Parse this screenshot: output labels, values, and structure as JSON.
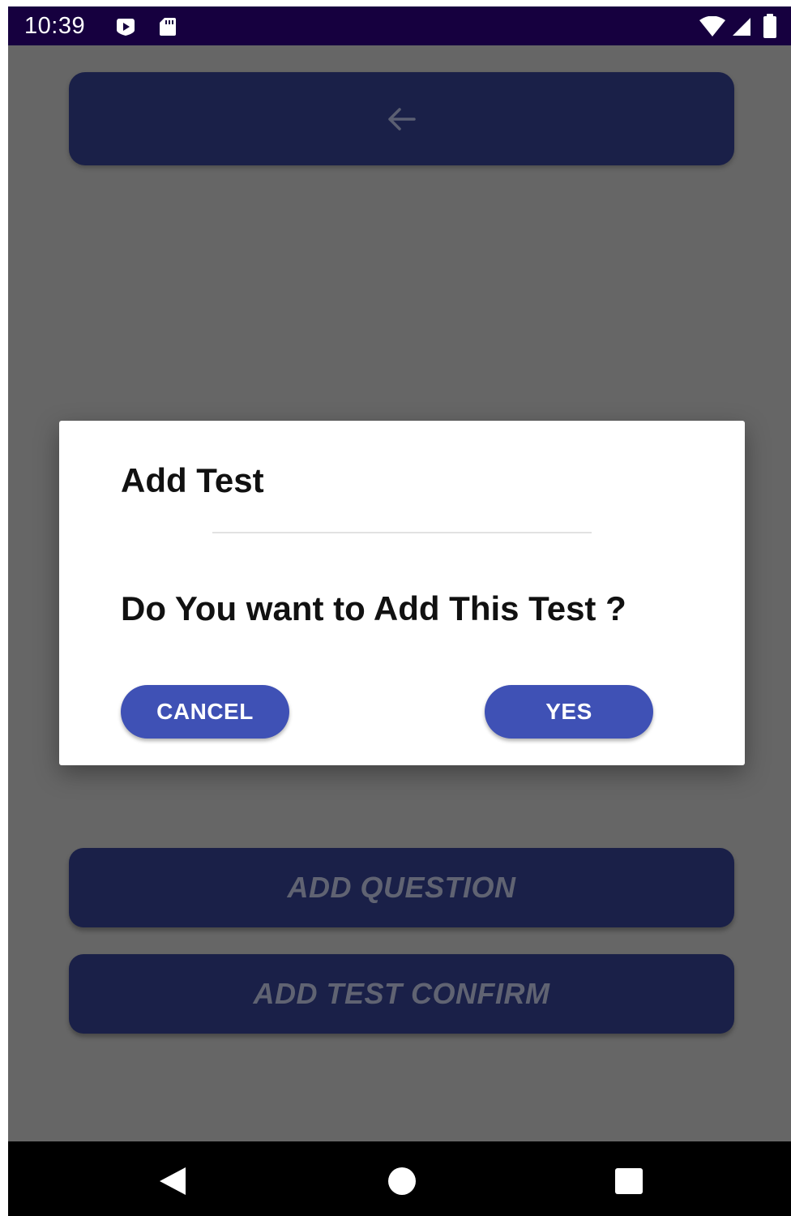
{
  "status_bar": {
    "time": "10:39",
    "left_icons": [
      "play-protect-icon",
      "sd-card-icon"
    ],
    "right_icons": [
      "wifi-icon",
      "signal-icon",
      "battery-icon"
    ]
  },
  "app_bar": {
    "back_icon": "arrow-left-icon"
  },
  "background_buttons": {
    "add_question": "ADD QUESTION",
    "add_test_confirm": "ADD TEST CONFIRM"
  },
  "dialog": {
    "title": "Add Test",
    "message": "Do You want to Add This Test ?",
    "cancel_label": "CANCEL",
    "yes_label": "YES"
  },
  "nav_bar": {
    "icons": [
      "back-triangle-icon",
      "home-circle-icon",
      "recents-square-icon"
    ]
  },
  "colors": {
    "status_bar": "#16003f",
    "scrim": "#666666",
    "app_primary_dimmed": "#1a2048",
    "dialog_button": "#3f51b5",
    "dialog_background": "#ffffff"
  }
}
